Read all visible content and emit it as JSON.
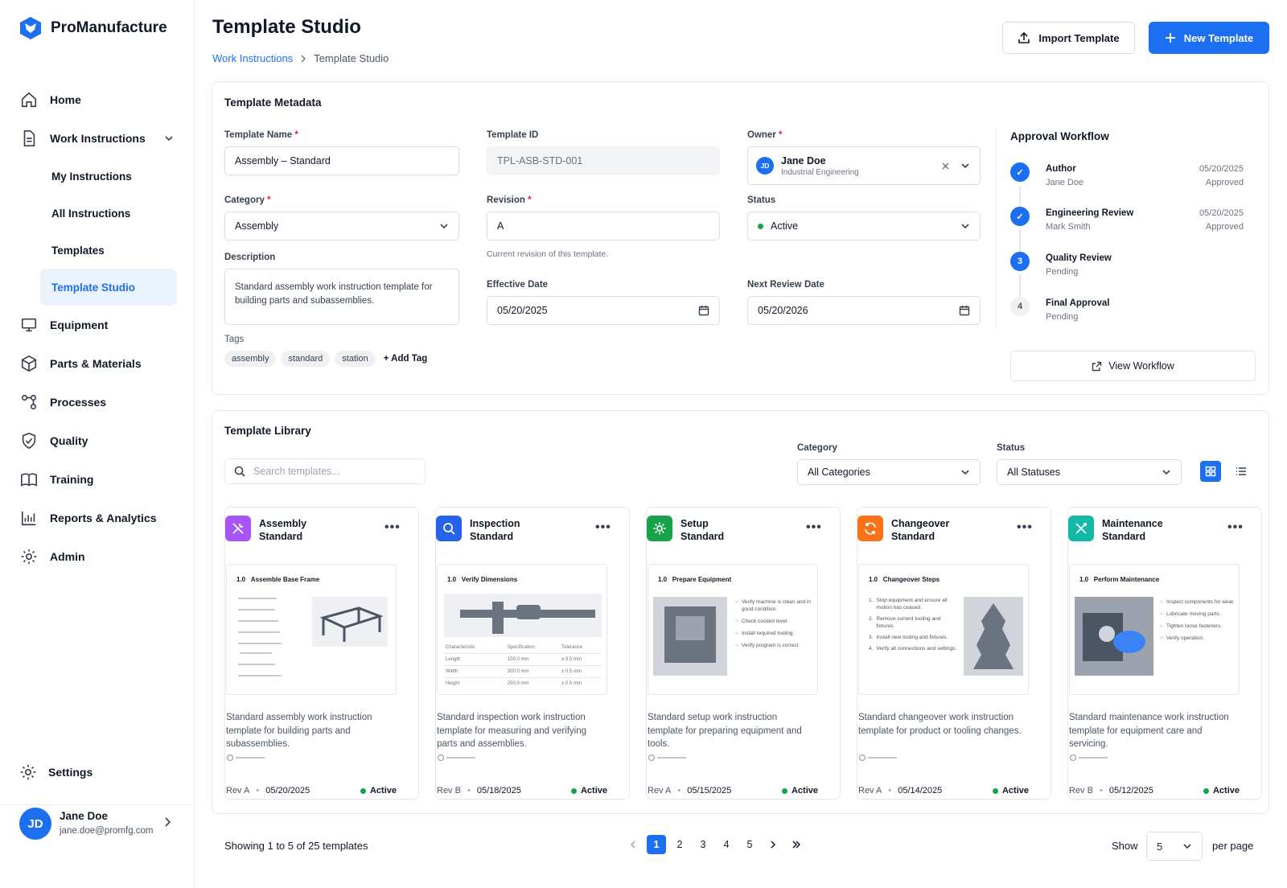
{
  "app": {
    "name": "ProManufacture"
  },
  "colors": {
    "accent": "#1d6ff2",
    "active": "#16a34a"
  },
  "nav": {
    "items": [
      {
        "label": "Home",
        "icon": "home-icon"
      },
      {
        "label": "Work Instructions",
        "icon": "document-icon"
      },
      {
        "label": "Equipment",
        "icon": "monitor-icon"
      },
      {
        "label": "Parts & Materials",
        "icon": "box-icon"
      },
      {
        "label": "Processes",
        "icon": "process-icon"
      },
      {
        "label": "Quality",
        "icon": "shield-icon"
      },
      {
        "label": "Training",
        "icon": "training-icon"
      },
      {
        "label": "Reports & Analytics",
        "icon": "chart-icon"
      },
      {
        "label": "Admin",
        "icon": "gear-icon"
      }
    ],
    "sub_items": [
      "My Instructions",
      "All Instructions",
      "Templates",
      "Template Studio"
    ],
    "settings": "Settings"
  },
  "user": {
    "initials": "JD",
    "name": "Jane Doe",
    "email": "jane.doe@promfg.com"
  },
  "header": {
    "title": "Template Studio",
    "breadcrumb": [
      "Work Instructions",
      "Template Studio"
    ],
    "import_label": "Import Template",
    "new_label": "New Template"
  },
  "metadata": {
    "title": "Template Metadata",
    "template_name": {
      "label": "Template Name",
      "value": "Assembly – Standard"
    },
    "template_id": {
      "label": "Template ID",
      "value": "TPL-ASB-STD-001"
    },
    "owner": {
      "label": "Owner",
      "initials": "JD",
      "name": "Jane Doe",
      "dept": "Industrial Engineering"
    },
    "category": {
      "label": "Category",
      "value": "Assembly"
    },
    "revision": {
      "label": "Revision",
      "value": "A",
      "hint": "Current revision of this template."
    },
    "status": {
      "label": "Status",
      "value": "Active"
    },
    "description": {
      "label": "Description",
      "value": "Standard assembly work instruction template for building parts and subassemblies."
    },
    "effective_date": {
      "label": "Effective Date",
      "value": "05/20/2025"
    },
    "next_review_date": {
      "label": "Next Review Date",
      "value": "05/20/2026"
    },
    "tags": {
      "label": "Tags",
      "items": [
        "assembly",
        "standard",
        "station"
      ],
      "add_label": "+ Add Tag"
    }
  },
  "workflow": {
    "title": "Approval Workflow",
    "steps": [
      {
        "name": "Author",
        "who": "Jane Doe",
        "date": "05/20/2025",
        "state": "Approved",
        "marker": "✓"
      },
      {
        "name": "Engineering Review",
        "who": "Mark Smith",
        "date": "05/20/2025",
        "state": "Approved",
        "marker": "✓"
      },
      {
        "name": "Quality Review",
        "who": "Pending",
        "date": "",
        "state": "",
        "marker": "3"
      },
      {
        "name": "Final Approval",
        "who": "Pending",
        "date": "",
        "state": "",
        "marker": "4"
      }
    ],
    "view_label": "View Workflow"
  },
  "library": {
    "title": "Template Library",
    "search_placeholder": "Search templates...",
    "category_label": "Category",
    "category_value": "All Categories",
    "status_label": "Status",
    "status_value": "All Statuses",
    "cards": [
      {
        "name1": "Assembly",
        "name2": "Standard",
        "icon": "wrench-icon",
        "color": "#a855f7",
        "step": "1.0",
        "step_title": "Assemble Base Frame",
        "desc": "Standard assembly work instruction template for building parts and subassemblies.",
        "rev": "Rev A",
        "date": "05/20/2025",
        "status": "Active"
      },
      {
        "name1": "Inspection",
        "name2": "Standard",
        "icon": "magnifier-icon",
        "color": "#2563eb",
        "step": "1.0",
        "step_title": "Verify Dimensions",
        "table_head": [
          "Characteristic",
          "Specification",
          "Tolerance"
        ],
        "table_rows": [
          [
            "Length",
            "150.0 mm",
            "± 0.5 mm"
          ],
          [
            "Width",
            "300.0 mm",
            "± 0.5 mm"
          ],
          [
            "Height",
            "250.0 mm",
            "± 0.5 mm"
          ]
        ],
        "desc": "Standard inspection work instruction template for measuring and verifying parts and assemblies.",
        "rev": "Rev B",
        "date": "05/18/2025",
        "status": "Active"
      },
      {
        "name1": "Setup",
        "name2": "Standard",
        "icon": "cog-icon",
        "color": "#16a34a",
        "step": "1.0",
        "step_title": "Prepare Equipment",
        "checks": [
          "Verify machine is clean and in good condition.",
          "Check coolant level.",
          "Install required tooling.",
          "Verify program is correct."
        ],
        "desc": "Standard setup work instruction template for preparing equipment and tools.",
        "rev": "Rev A",
        "date": "05/15/2025",
        "status": "Active"
      },
      {
        "name1": "Changeover",
        "name2": "Standard",
        "icon": "refresh-icon",
        "color": "#f97316",
        "step": "1.0",
        "step_title": "Changeover Steps",
        "numbered": [
          "Stop equipment and ensure all motion has ceased.",
          "Remove current tooling and fixtures.",
          "Install new tooling and fixtures.",
          "Verify all connections and settings."
        ],
        "desc": "Standard changeover work instruction template for product or tooling changes.",
        "rev": "Rev A",
        "date": "05/14/2025",
        "status": "Active"
      },
      {
        "name1": "Maintenance",
        "name2": "Standard",
        "icon": "tools-icon",
        "color": "#14b8a6",
        "step": "1.0",
        "step_title": "Perform Maintenance",
        "checks": [
          "Inspect components for wear.",
          "Lubricate moving parts.",
          "Tighten loose fasteners.",
          "Verify operation."
        ],
        "desc": "Standard maintenance work instruction template for equipment care and servicing.",
        "rev": "Rev B",
        "date": "05/12/2025",
        "status": "Active"
      }
    ]
  },
  "pagination": {
    "info": "Showing 1 to 5 of 25 templates",
    "pages": [
      "1",
      "2",
      "3",
      "4",
      "5"
    ],
    "current": 1,
    "show_label": "Show",
    "per_page_value": "5",
    "per_page_label": "per page"
  }
}
